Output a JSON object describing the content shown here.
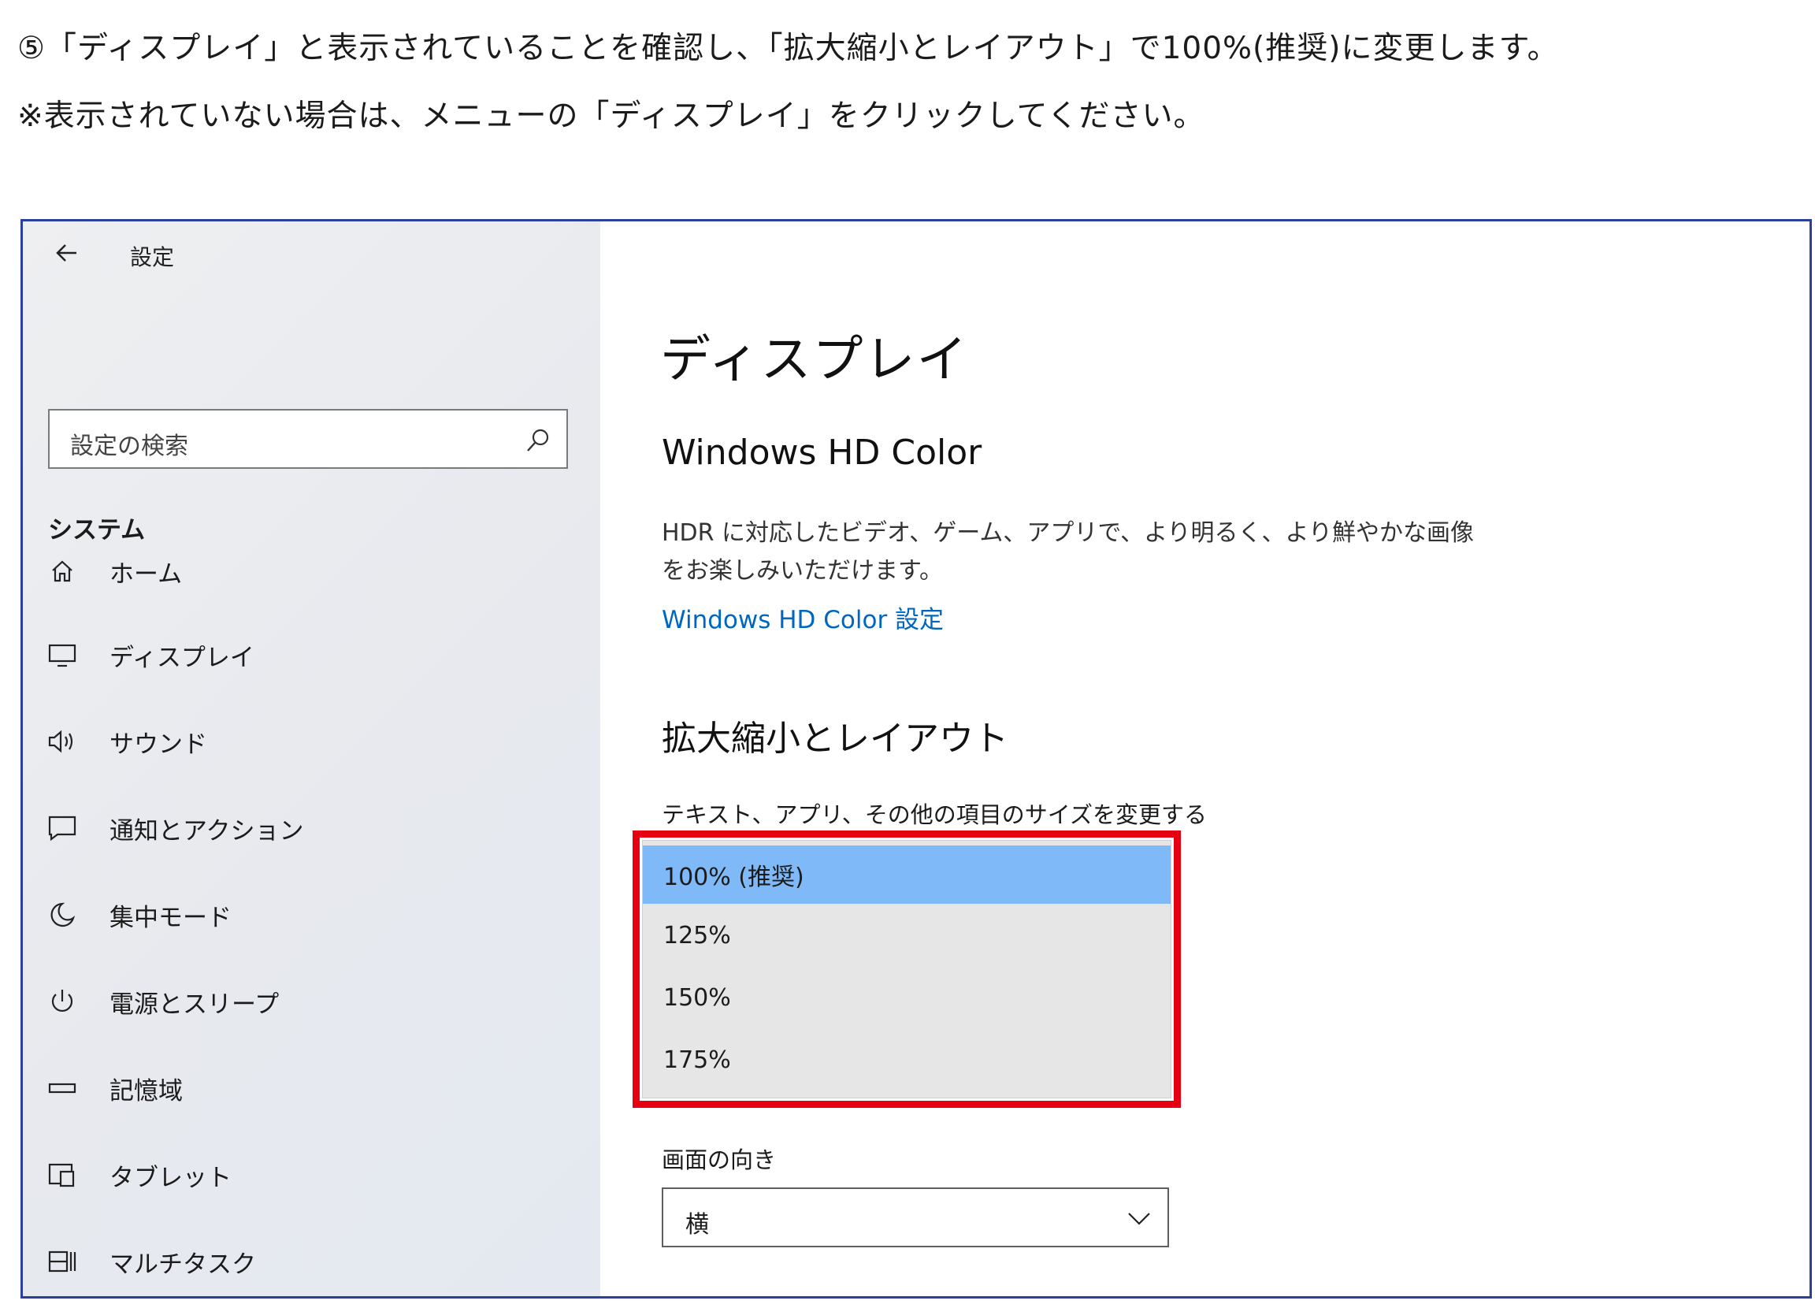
{
  "instructions": {
    "line1": "⑤「ディスプレイ」と表示されていることを確認し、「拡大縮小とレイアウト」で100%(推奨)に変更します。",
    "line2": "※表示されていない場合は、メニューの「ディスプレイ」をクリックしてください。"
  },
  "window": {
    "title": "設定",
    "controls": {
      "minimize": "—",
      "maximize": "☐",
      "close": "✕"
    }
  },
  "sidebar": {
    "home": {
      "label": "ホーム",
      "icon": "home-icon"
    },
    "search": {
      "placeholder": "設定の検索",
      "icon": "search-icon"
    },
    "section": "システム",
    "items": [
      {
        "label": "ディスプレイ",
        "icon": "monitor-icon"
      },
      {
        "label": "サウンド",
        "icon": "speaker-icon"
      },
      {
        "label": "通知とアクション",
        "icon": "notification-icon"
      },
      {
        "label": "集中モード",
        "icon": "moon-icon"
      },
      {
        "label": "電源とスリープ",
        "icon": "power-icon"
      },
      {
        "label": "記憶域",
        "icon": "storage-icon"
      },
      {
        "label": "タブレット",
        "icon": "tablet-icon"
      },
      {
        "label": "マルチタスク",
        "icon": "multitask-icon"
      }
    ]
  },
  "main": {
    "title": "ディスプレイ",
    "hdr": {
      "heading": "Windows HD Color",
      "description": "HDR に対応したビデオ、ゲーム、アプリで、より明るく、より鮮やかな画像をお楽しみいただけます。",
      "link": "Windows HD Color 設定"
    },
    "scale": {
      "heading": "拡大縮小とレイアウト",
      "label": "テキスト、アプリ、その他の項目のサイズを変更する",
      "options": [
        "100% (推奨)",
        "125%",
        "150%",
        "175%"
      ],
      "selected_index": 0
    },
    "orientation": {
      "label": "画面の向き",
      "value": "横"
    }
  },
  "colors": {
    "highlight_border": "#e50012",
    "selected_option": "#7fb9f7",
    "link": "#0067c0",
    "window_border": "#2b3f9c"
  }
}
